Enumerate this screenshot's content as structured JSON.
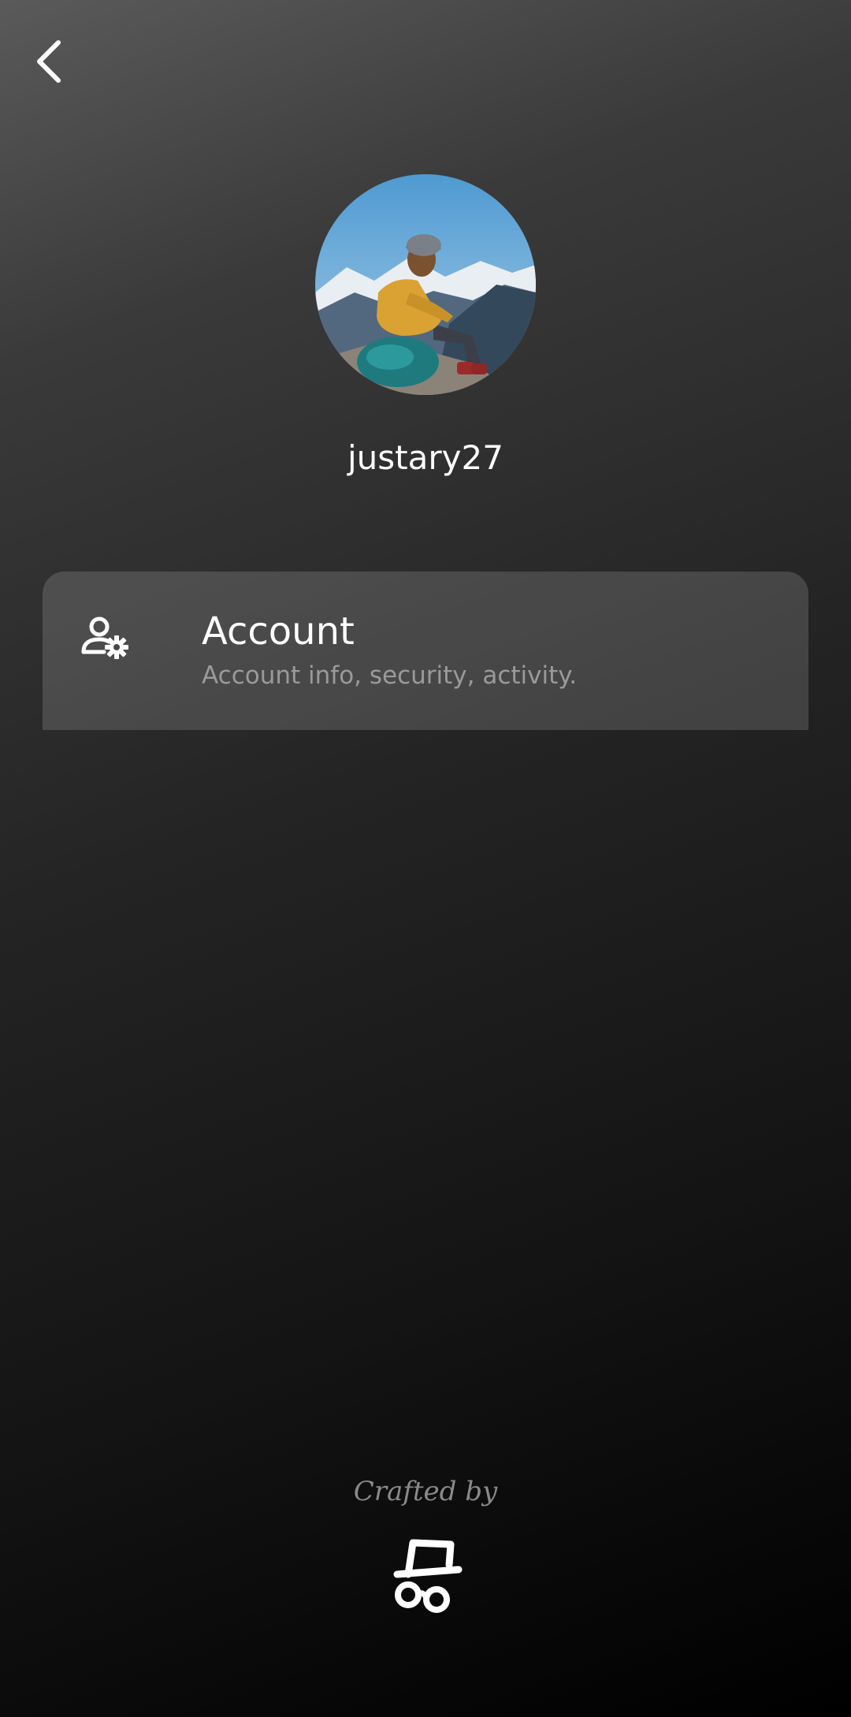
{
  "header": {
    "back_icon": "chevron-left-icon"
  },
  "profile": {
    "username": "justary27",
    "avatar_alt": "hiker sitting on rock with mountains"
  },
  "settings": {
    "items": [
      {
        "icon": "user-gear-icon",
        "title": "Account",
        "subtitle": "Account info, security, activity."
      }
    ]
  },
  "footer": {
    "crafted_by": "Crafted by",
    "logo": "hat-glasses-logo"
  },
  "colors": {
    "card_bg": "#474747",
    "subtitle_text": "#9a9a9a",
    "footer_text": "#8a8a8a"
  }
}
